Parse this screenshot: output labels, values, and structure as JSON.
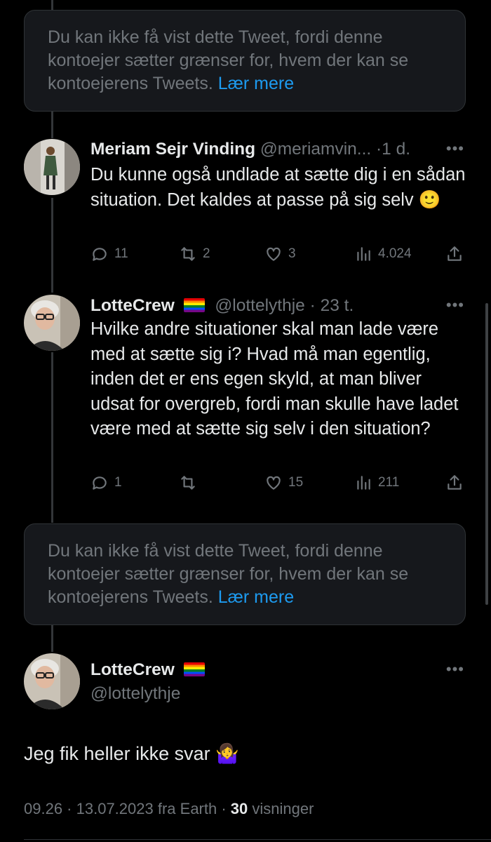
{
  "notices": [
    {
      "text": "Du kan ikke få vist dette Tweet, fordi denne kontoejer sætter grænser for, hvem der kan se kontoejerens Tweets.",
      "more": "Lær mere"
    },
    {
      "text": "Du kan ikke få vist dette Tweet, fordi denne kontoejer sætter grænser for, hvem der kan se kontoejerens Tweets.",
      "more": "Lær mere"
    }
  ],
  "reply1": {
    "name": "Meriam Sejr Vinding",
    "handle": "@meriamvin...",
    "time": "1 d.",
    "text": "Du kunne også undlade at sætte dig i en sådan situation. Det kaldes at passe på sig selv",
    "emoji": "🙂",
    "replies": "11",
    "retweets": "2",
    "likes": "3",
    "views": "4.024"
  },
  "reply2": {
    "name": "LotteCrew",
    "handle": "@lottelythje",
    "time": "23 t.",
    "text": "Hvilke andre situationer skal man lade være med at sætte sig i? Hvad må man egentlig, inden det er ens egen skyld, at man bliver udsat for overgreb, fordi man skulle have ladet være med at sætte sig selv i den situation?",
    "replies": "1",
    "retweets": "",
    "likes": "15",
    "views": "211"
  },
  "main": {
    "name": "LotteCrew",
    "handle": "@lottelythje",
    "text": "Jeg fik heller ikke svar",
    "emoji": "🤷‍♀️",
    "time": "09.26",
    "date": "13.07.2023",
    "source": "fra Earth",
    "views_count": "30",
    "views_label": "visninger"
  },
  "icons": [
    "reply-icon",
    "retweet-icon",
    "like-icon",
    "views-icon",
    "share-icon",
    "more-icon",
    "rainbow-flag-icon"
  ]
}
